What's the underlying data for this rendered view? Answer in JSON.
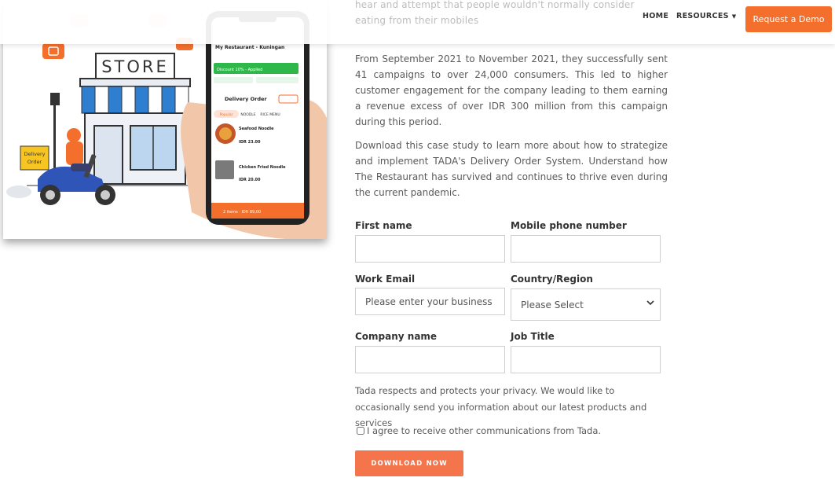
{
  "header": {
    "faded_text_1": "hear and attempt that people wouldn't normally consider",
    "faded_text_2": "eating from their mobiles",
    "nav_home": "HOME",
    "nav_resources": "RESOURCES",
    "request_demo": "Request a Demo"
  },
  "illustration": {
    "store_sign": "STORE",
    "delivery_box_line1": "Delivery",
    "delivery_box_line2": "Order",
    "phone_restaurant": "My Restaurant - Kuningan",
    "phone_status": "Discount 10% - Applied",
    "phone_section": "Delivery Order",
    "phone_tabs": [
      "Popular",
      "NOODLE",
      "RICE MENU"
    ],
    "phone_items": [
      {
        "name": "Seafood Noodle",
        "price": "IDR 23.00"
      },
      {
        "name": "Chicken Fried Noodle",
        "price": "IDR 20.00"
      }
    ],
    "phone_cart": "2 items · IDR 89,00"
  },
  "article": {
    "para1": "From September 2021 to November 2021, they successfully sent 41 campaigns to over 24,000 consumers. This led to higher customer engagement for the company leading to them earning a revenue excess of over IDR 300 million from this campaign during this period.",
    "para2": "Download this case study to learn more about how to strategize and implement TADA's Delivery Order System. Understand how The Restaurant  has survived and continues to thrive even during the current pandemic."
  },
  "form": {
    "first_name_label": "First name",
    "mobile_label": "Mobile phone number",
    "email_label": "Work Email",
    "email_placeholder": "Please enter your business e",
    "country_label": "Country/Region",
    "country_selected": "Please Select",
    "company_label": "Company name",
    "job_label": "Job Title",
    "privacy_text": "Tada respects and protects your privacy. We would like to occasionally send you information about our latest products and services",
    "consent_text": "I agree to receive other communications from Tada.",
    "download_label": "DOWNLOAD NOW"
  },
  "colors": {
    "accent": "#f46f2b",
    "download_button": "#f4744b"
  }
}
